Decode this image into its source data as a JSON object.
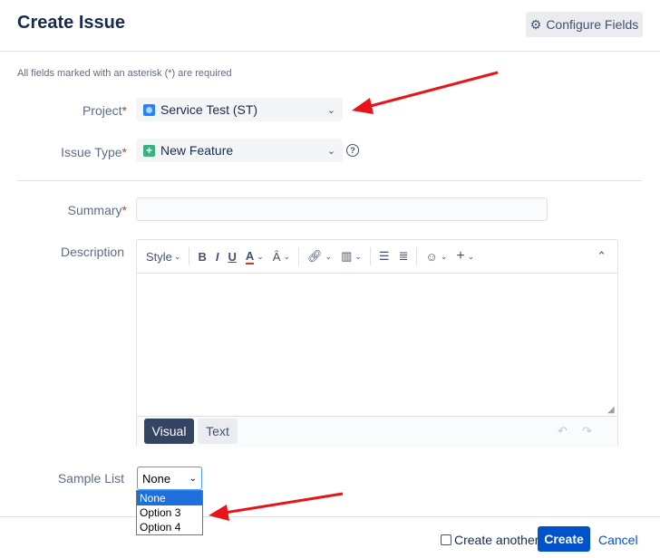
{
  "dialog": {
    "title": "Create Issue",
    "configure_fields_label": "Configure Fields",
    "required_note": "All fields marked with an asterisk (*) are required"
  },
  "fields": {
    "project": {
      "label": "Project",
      "value": "Service Test (ST)"
    },
    "issue_type": {
      "label": "Issue Type",
      "value": "New Feature"
    },
    "summary": {
      "label": "Summary",
      "value": ""
    },
    "description": {
      "label": "Description"
    },
    "sample_list": {
      "label": "Sample List",
      "value": "None",
      "options": [
        "None",
        "Option 3",
        "Option 4"
      ]
    }
  },
  "editor": {
    "toolbar": {
      "style_label": "Style",
      "bold": "B",
      "italic": "I",
      "underline": "U",
      "text_color": "A"
    },
    "tabs": {
      "visual": "Visual",
      "text": "Text"
    }
  },
  "footer": {
    "create_another_label": "Create another",
    "create_label": "Create",
    "cancel_label": "Cancel"
  },
  "colors": {
    "primary": "#0052cc",
    "required_asterisk": "#de350b",
    "annotation_arrow": "#e8141a"
  }
}
